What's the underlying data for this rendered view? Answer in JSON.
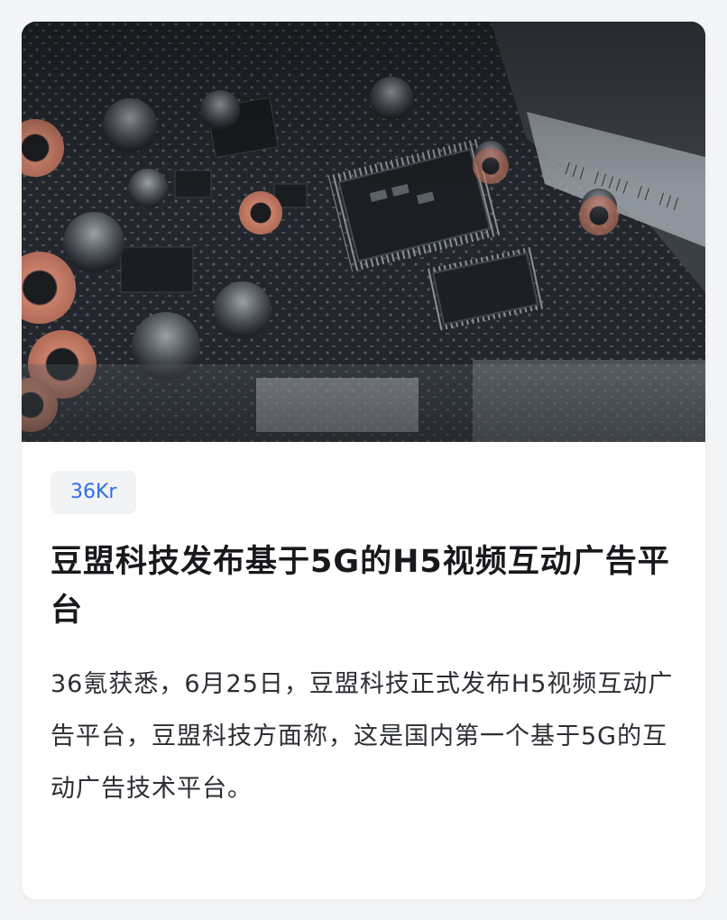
{
  "article": {
    "image_description": "circuit-board-photo",
    "source": "36Kr",
    "title": "豆盟科技发布基于5G的H5视频互动广告平台",
    "summary": "36氪获悉，6月25日，豆盟科技正式发布H5视频互动广告平台，豆盟科技方面称，这是国内第一个基于5G的互动广告技术平台。"
  },
  "colors": {
    "accent": "#2f6fe8",
    "title": "#17191c",
    "body": "#2b2e33",
    "tag_bg": "#f2f3f5",
    "card_bg": "#ffffff"
  }
}
